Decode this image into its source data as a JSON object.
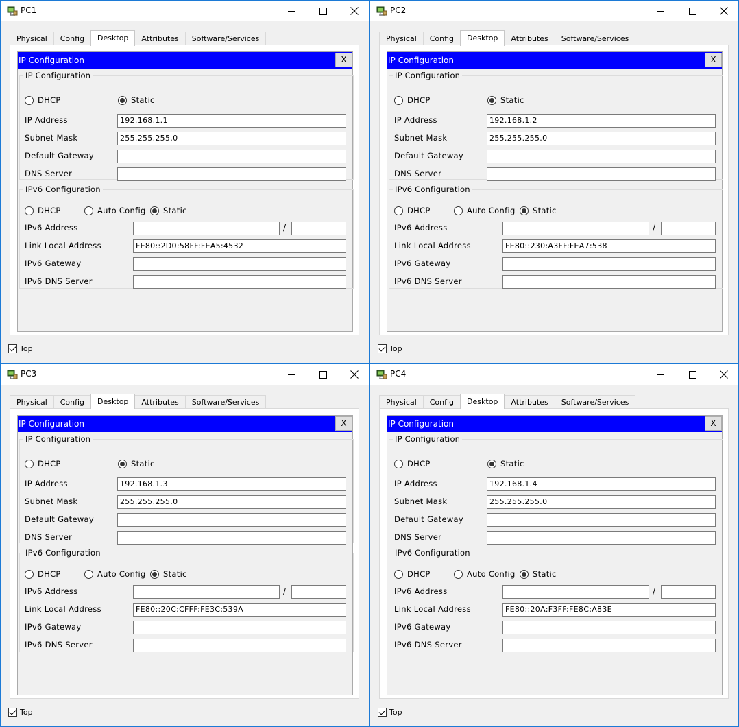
{
  "windows": [
    {
      "title": "PC1",
      "tabs": [
        "Physical",
        "Config",
        "Desktop",
        "Attributes",
        "Software/Services"
      ],
      "active_tab": "Desktop",
      "panel_title": "IP Configuration",
      "close_label": "X",
      "ipv4": {
        "legend": "IP Configuration",
        "dhcp_label": "DHCP",
        "static_label": "Static",
        "mode": "Static",
        "ip_label": "IP Address",
        "ip_value": "192.168.1.1",
        "mask_label": "Subnet Mask",
        "mask_value": "255.255.255.0",
        "gateway_label": "Default Gateway",
        "gateway_value": "",
        "dns_label": "DNS Server",
        "dns_value": ""
      },
      "ipv6": {
        "legend": "IPv6 Configuration",
        "dhcp_label": "DHCP",
        "auto_label": "Auto Config",
        "static_label": "Static",
        "mode": "Static",
        "address_label": "IPv6 Address",
        "address_value": "",
        "prefix_sep": "/",
        "prefix_value": "",
        "link_local_label": "Link Local Address",
        "link_local_value": "FE80::2D0:58FF:FEA5:4532",
        "gateway_label": "IPv6 Gateway",
        "gateway_value": "",
        "dns_label": "IPv6 DNS Server",
        "dns_value": ""
      },
      "top_label": "Top",
      "top_checked": true
    },
    {
      "title": "PC2",
      "tabs": [
        "Physical",
        "Config",
        "Desktop",
        "Attributes",
        "Software/Services"
      ],
      "active_tab": "Desktop",
      "panel_title": "IP Configuration",
      "close_label": "X",
      "ipv4": {
        "legend": "IP Configuration",
        "dhcp_label": "DHCP",
        "static_label": "Static",
        "mode": "Static",
        "ip_label": "IP Address",
        "ip_value": "192.168.1.2",
        "mask_label": "Subnet Mask",
        "mask_value": "255.255.255.0",
        "gateway_label": "Default Gateway",
        "gateway_value": "",
        "dns_label": "DNS Server",
        "dns_value": ""
      },
      "ipv6": {
        "legend": "IPv6 Configuration",
        "dhcp_label": "DHCP",
        "auto_label": "Auto Config",
        "static_label": "Static",
        "mode": "Static",
        "address_label": "IPv6 Address",
        "address_value": "",
        "prefix_sep": "/",
        "prefix_value": "",
        "link_local_label": "Link Local Address",
        "link_local_value": "FE80::230:A3FF:FEA7:538",
        "gateway_label": "IPv6 Gateway",
        "gateway_value": "",
        "dns_label": "IPv6 DNS Server",
        "dns_value": ""
      },
      "top_label": "Top",
      "top_checked": true
    },
    {
      "title": "PC3",
      "tabs": [
        "Physical",
        "Config",
        "Desktop",
        "Attributes",
        "Software/Services"
      ],
      "active_tab": "Desktop",
      "panel_title": "IP Configuration",
      "close_label": "X",
      "ipv4": {
        "legend": "IP Configuration",
        "dhcp_label": "DHCP",
        "static_label": "Static",
        "mode": "Static",
        "ip_label": "IP Address",
        "ip_value": "192.168.1.3",
        "mask_label": "Subnet Mask",
        "mask_value": "255.255.255.0",
        "gateway_label": "Default Gateway",
        "gateway_value": "",
        "dns_label": "DNS Server",
        "dns_value": ""
      },
      "ipv6": {
        "legend": "IPv6 Configuration",
        "dhcp_label": "DHCP",
        "auto_label": "Auto Config",
        "static_label": "Static",
        "mode": "Static",
        "address_label": "IPv6 Address",
        "address_value": "",
        "prefix_sep": "/",
        "prefix_value": "",
        "link_local_label": "Link Local Address",
        "link_local_value": "FE80::20C:CFFF:FE3C:539A",
        "gateway_label": "IPv6 Gateway",
        "gateway_value": "",
        "dns_label": "IPv6 DNS Server",
        "dns_value": ""
      },
      "top_label": "Top",
      "top_checked": true
    },
    {
      "title": "PC4",
      "tabs": [
        "Physical",
        "Config",
        "Desktop",
        "Attributes",
        "Software/Services"
      ],
      "active_tab": "Desktop",
      "panel_title": "IP Configuration",
      "close_label": "X",
      "ipv4": {
        "legend": "IP Configuration",
        "dhcp_label": "DHCP",
        "static_label": "Static",
        "mode": "Static",
        "ip_label": "IP Address",
        "ip_value": "192.168.1.4",
        "mask_label": "Subnet Mask",
        "mask_value": "255.255.255.0",
        "gateway_label": "Default Gateway",
        "gateway_value": "",
        "dns_label": "DNS Server",
        "dns_value": ""
      },
      "ipv6": {
        "legend": "IPv6 Configuration",
        "dhcp_label": "DHCP",
        "auto_label": "Auto Config",
        "static_label": "Static",
        "mode": "Static",
        "address_label": "IPv6 Address",
        "address_value": "",
        "prefix_sep": "/",
        "prefix_value": "",
        "link_local_label": "Link Local Address",
        "link_local_value": "FE80::20A:F3FF:FE8C:A83E",
        "gateway_label": "IPv6 Gateway",
        "gateway_value": "",
        "dns_label": "IPv6 DNS Server",
        "dns_value": ""
      },
      "top_label": "Top",
      "top_checked": true
    }
  ],
  "colors": {
    "window_border": "#1c7ad6",
    "panel_title_bar": "#0000ff",
    "panel_title_text": "#ffffff",
    "dialog_bg": "#f0f0f0"
  },
  "icons": {
    "window_icon": "packet-tracer-pc-icon",
    "minimize": "minimize-icon",
    "maximize": "maximize-icon",
    "close": "close-icon",
    "checkbox": "checkbox-checked-icon"
  }
}
